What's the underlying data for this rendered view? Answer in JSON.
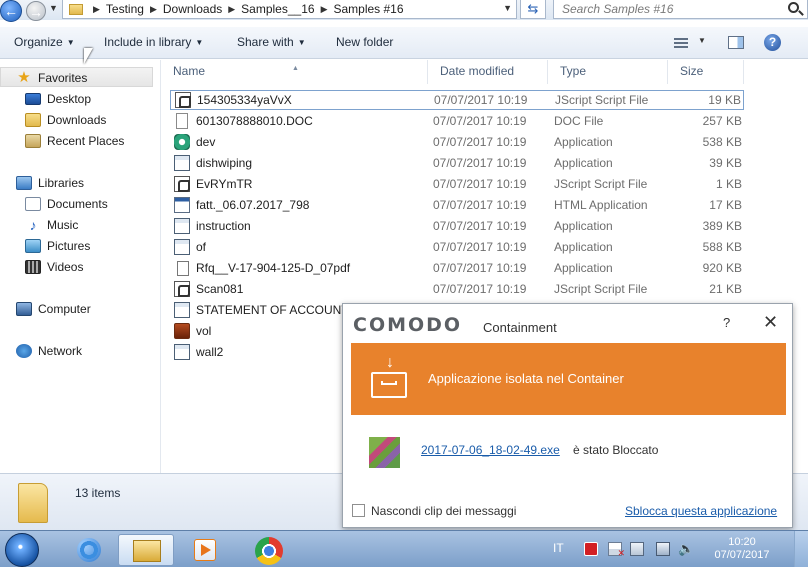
{
  "address": {
    "breadcrumbs": [
      "Testing",
      "Downloads",
      "Samples__16",
      "Samples #16"
    ],
    "search_placeholder": "Search Samples #16"
  },
  "toolbar": {
    "organize": "Organize",
    "include_in_library": "Include in library",
    "share_with": "Share with",
    "new_folder": "New folder"
  },
  "nav": {
    "favorites": "Favorites",
    "desktop": "Desktop",
    "downloads": "Downloads",
    "recent_places": "Recent Places",
    "libraries": "Libraries",
    "documents": "Documents",
    "music": "Music",
    "pictures": "Pictures",
    "videos": "Videos",
    "computer": "Computer",
    "network": "Network"
  },
  "columns": {
    "name": "Name",
    "date_modified": "Date modified",
    "type": "Type",
    "size": "Size"
  },
  "files": [
    {
      "name": "154305334yaVvX",
      "date": "07/07/2017 10:19",
      "type": "JScript Script File",
      "size": "19 KB",
      "icon": "jscript-icon"
    },
    {
      "name": "6013078888010.DOC",
      "date": "07/07/2017 10:19",
      "type": "DOC File",
      "size": "257 KB",
      "icon": "document-file-icon"
    },
    {
      "name": "dev",
      "date": "07/07/2017 10:19",
      "type": "Application",
      "size": "538 KB",
      "icon": "application-icon"
    },
    {
      "name": "dishwiping",
      "date": "07/07/2017 10:19",
      "type": "Application",
      "size": "39 KB",
      "icon": "application-icon"
    },
    {
      "name": "EvRYmTR",
      "date": "07/07/2017 10:19",
      "type": "JScript Script File",
      "size": "1 KB",
      "icon": "jscript-icon"
    },
    {
      "name": "fatt._06.07.2017_798",
      "date": "07/07/2017 10:19",
      "type": "HTML Application",
      "size": "17 KB",
      "icon": "html-application-icon"
    },
    {
      "name": "instruction",
      "date": "07/07/2017 10:19",
      "type": "Application",
      "size": "389 KB",
      "icon": "application-icon"
    },
    {
      "name": "of",
      "date": "07/07/2017 10:19",
      "type": "Application",
      "size": "588 KB",
      "icon": "application-icon"
    },
    {
      "name": "Rfq__V-17-904-125-D_07pdf",
      "date": "07/07/2017 10:19",
      "type": "Application",
      "size": "920 KB",
      "icon": "shortcut-icon"
    },
    {
      "name": "Scan081",
      "date": "07/07/2017 10:19",
      "type": "JScript Script File",
      "size": "21 KB",
      "icon": "jscript-icon"
    },
    {
      "name": "STATEMENT OF ACCOUNT",
      "date": "",
      "type": "",
      "size": "",
      "icon": "application-icon"
    },
    {
      "name": "vol",
      "date": "",
      "type": "",
      "size": "",
      "icon": "volume-app-icon"
    },
    {
      "name": "wall2",
      "date": "",
      "type": "",
      "size": "",
      "icon": "application-icon"
    }
  ],
  "status": {
    "item_count": "13 items"
  },
  "comodo": {
    "logo": "COMODO",
    "title": "Containment",
    "help": "?",
    "close": "✕",
    "banner": "Applicazione isolata nel Container",
    "file_link": "2017-07-06_18-02-49.exe",
    "file_state": "è stato Bloccato",
    "hide_label": "Nascondi clip dei messaggi",
    "unblock_link": "Sblocca questa applicazione"
  },
  "taskbar": {
    "lang": "IT",
    "time": "10:20",
    "date": "07/07/2017"
  },
  "colors": {
    "comodo_orange": "#e8822c",
    "link_blue": "#1a5caa"
  }
}
